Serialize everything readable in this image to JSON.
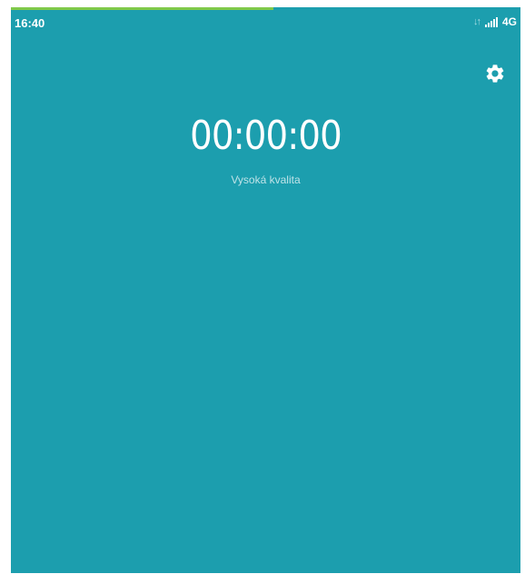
{
  "status_bar": {
    "time": "16:40",
    "network_type": "4G",
    "data_arrows": "↓↑"
  },
  "recorder": {
    "timer": "00:00:00",
    "quality_label": "Vysoká kvalita"
  },
  "icons": {
    "settings": "gear-icon",
    "signal": "signal-icon"
  },
  "colors": {
    "background": "#1c9eae",
    "progress": "#7fc94a",
    "text": "#ffffff"
  }
}
